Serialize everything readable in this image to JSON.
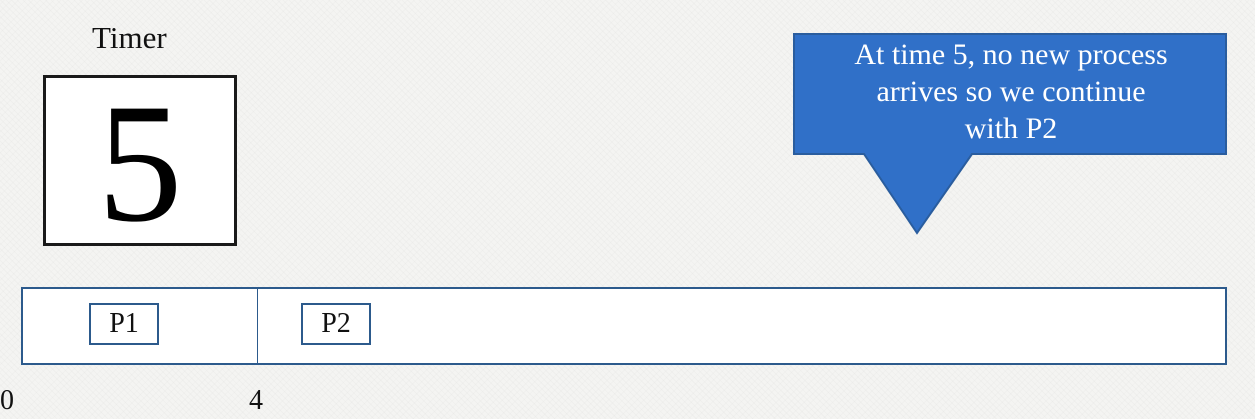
{
  "timer": {
    "label": "Timer",
    "value": "5"
  },
  "callout": {
    "text_line1": "At time 5, no new process",
    "text_line2": "arrives so we continue",
    "text_line3": "with P2",
    "color": "#3070c8"
  },
  "gantt": {
    "processes": [
      {
        "label": "P1"
      },
      {
        "label": "P2"
      }
    ],
    "ticks": [
      "0",
      "4"
    ],
    "border_color": "#2c5a8c"
  }
}
